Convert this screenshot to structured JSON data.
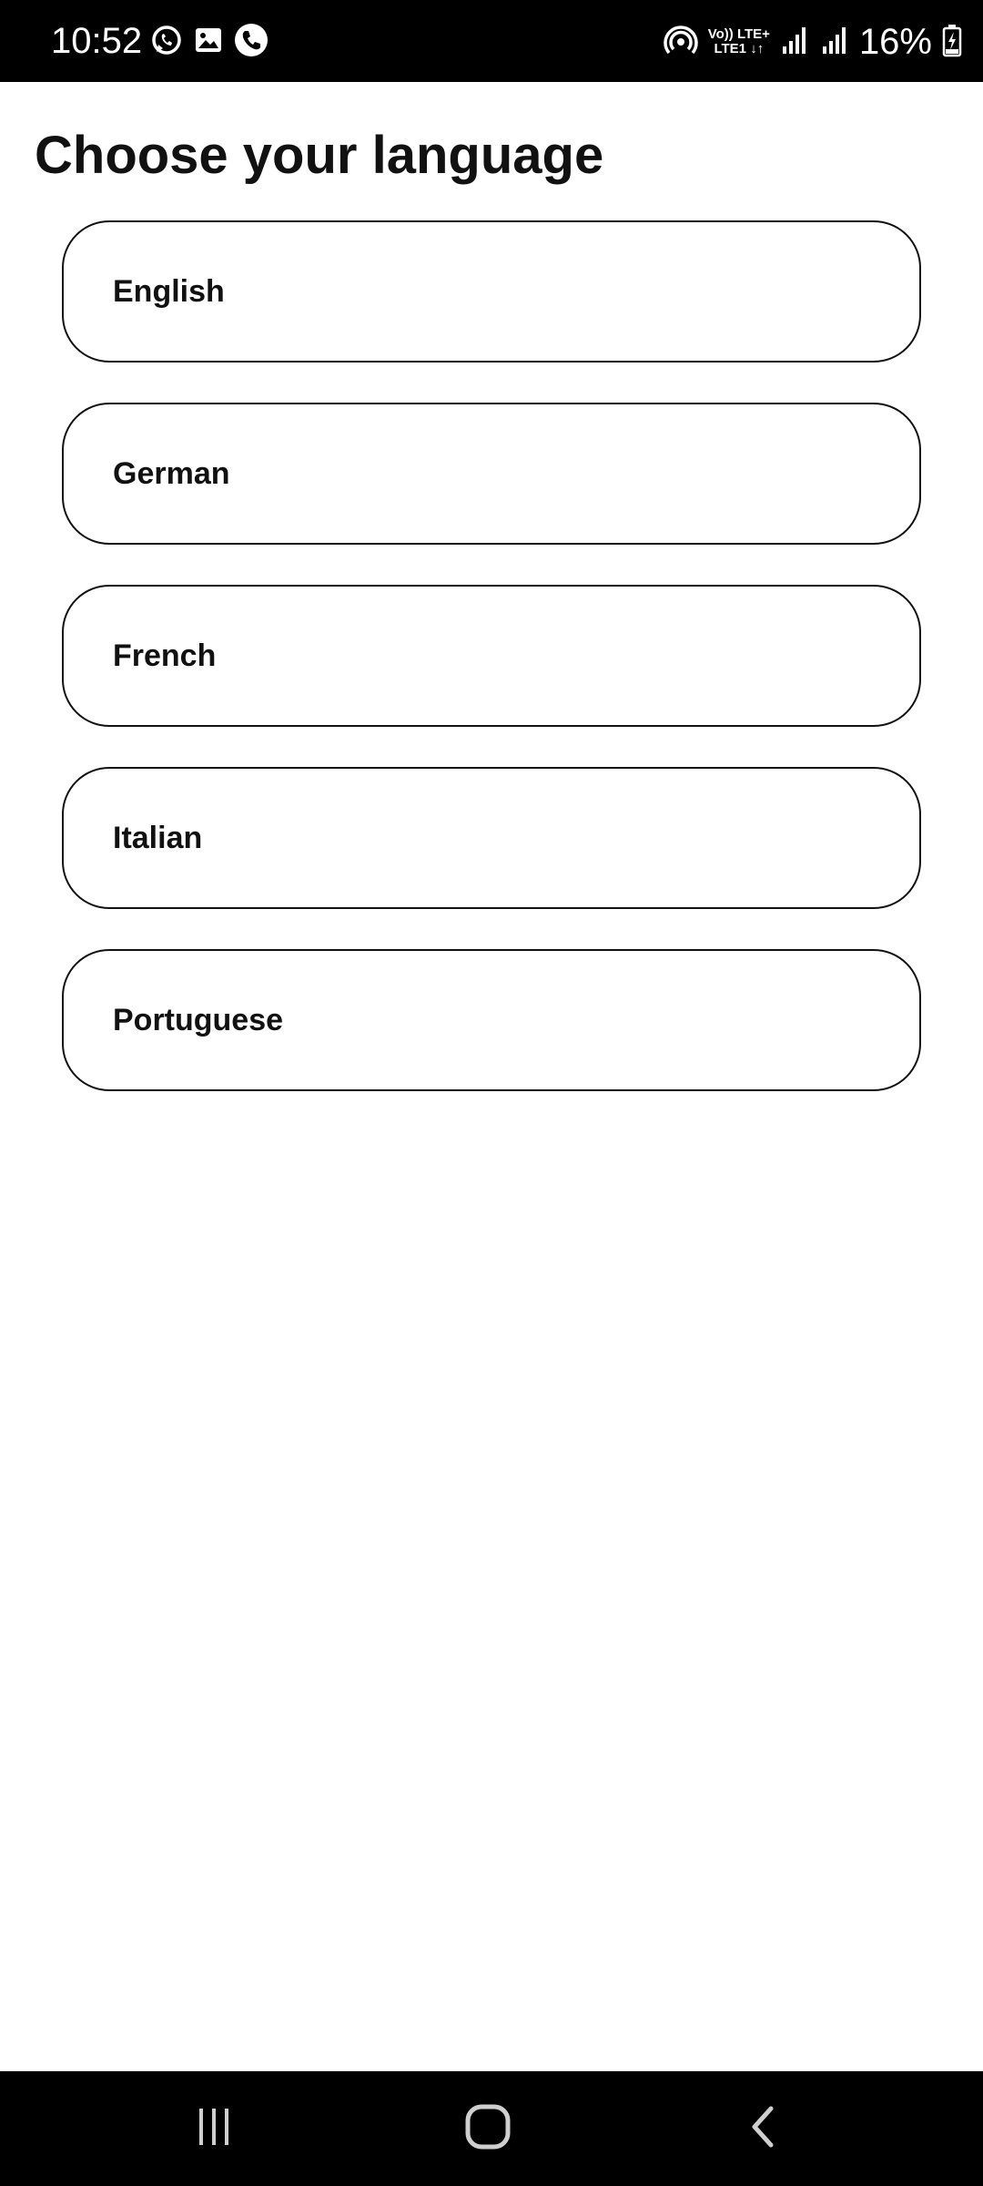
{
  "status_bar": {
    "time": "10:52",
    "left_icons": [
      "whatsapp-icon",
      "gallery-icon",
      "phone-call-icon"
    ],
    "network_line1_left": "Vo))",
    "network_line1_right": "LTE+",
    "network_line2": "LTE1",
    "battery_percent": "16%",
    "right_icons": [
      "hotspot-icon",
      "signal-icon",
      "signal-icon",
      "battery-charging-icon"
    ]
  },
  "page": {
    "title": "Choose your language"
  },
  "languages": [
    {
      "label": "English"
    },
    {
      "label": "German"
    },
    {
      "label": "French"
    },
    {
      "label": "Italian"
    },
    {
      "label": "Portuguese"
    }
  ],
  "nav_bar": {
    "buttons": [
      "recent-apps-icon",
      "home-icon",
      "back-icon"
    ]
  },
  "colors": {
    "background": "#ffffff",
    "bars": "#000000",
    "text": "#111111",
    "border": "#111111"
  }
}
